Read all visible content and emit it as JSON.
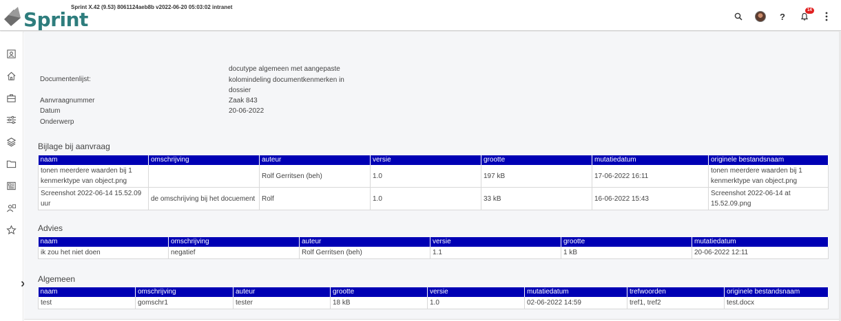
{
  "header": {
    "logo_text": "Sprint",
    "version": "Sprint X.42 (9.53) 8061124aeb8b v2022-06-20 05:03:02 intranet",
    "help_label": "?",
    "notification_count": "14",
    "icons": [
      "search-icon",
      "avatar",
      "help-icon",
      "bell-icon",
      "more-vert-icon"
    ]
  },
  "sidebar": {
    "items": [
      "contact-icon",
      "home-icon",
      "briefcase-icon",
      "sliders-icon",
      "layers-icon",
      "folder-icon",
      "newspaper-icon",
      "users-icon",
      "star-icon"
    ]
  },
  "info": {
    "doclist_label": "Documentenlijst:",
    "doclist_value": "docutype algemeen met aangepaste kolomindeling documentkenmerken in dossier",
    "aanvraag_label": "Aanvraagnummer",
    "aanvraag_value": "Zaak 843",
    "datum_label": "Datum",
    "datum_value": "20-06-2022",
    "onderwerp_label": "Onderwerp"
  },
  "bijlage": {
    "title": "Bijlage bij aanvraag",
    "columns": [
      "naam",
      "omschrijving",
      "auteur",
      "versie",
      "grootte",
      "mutatiedatum",
      "originele bestandsnaam"
    ],
    "rows": [
      [
        "tonen meerdere waarden bij 1 kenmerktype van object.png",
        "",
        "Rolf Gerritsen (beh)",
        "1.0",
        "197 kB",
        "17-06-2022 16:11",
        "tonen meerdere waarden bij 1 kenmerktype van object.png"
      ],
      [
        "Screenshot 2022-06-14 15.52.09 uur",
        "de omschrijving bij het docuement",
        "Rolf",
        "1.0",
        "33 kB",
        "16-06-2022 15:43",
        "Screenshot 2022-06-14 at 15.52.09.png"
      ]
    ]
  },
  "advies": {
    "title": "Advies",
    "columns": [
      "naam",
      "omschrijving",
      "auteur",
      "versie",
      "grootte",
      "mutatiedatum"
    ],
    "rows": [
      [
        "ik zou het niet doen",
        "negatief",
        "Rolf Gerritsen (beh)",
        "1.1",
        "1 kB",
        "20-06-2022 12:11"
      ]
    ]
  },
  "algemeen": {
    "title": "Algemeen",
    "columns": [
      "naam",
      "omschrijving",
      "auteur",
      "grootte",
      "versie",
      "mutatiedatum",
      "trefwoorden",
      "originele bestandsnaam"
    ],
    "rows": [
      [
        "test",
        "gomschr1",
        "tester",
        "18 kB",
        "1.0",
        "02-06-2022 14:59",
        "tref1, tref2",
        "test.docx"
      ]
    ]
  },
  "colors": {
    "table_header": "#0000b4",
    "logo": "#2e7d7d",
    "badge": "#e02020"
  }
}
